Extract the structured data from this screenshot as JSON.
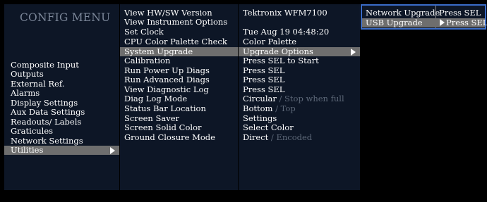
{
  "menu_title": "CONFIG MENU",
  "left_menu": [
    {
      "label": "Composite Input"
    },
    {
      "label": "Outputs"
    },
    {
      "label": "External Ref."
    },
    {
      "label": "Alarms"
    },
    {
      "label": "Display Settings"
    },
    {
      "label": "Aux Data Settings"
    },
    {
      "label": "Readouts/ Labels"
    },
    {
      "label": "Graticules"
    },
    {
      "label": "Network Settings"
    },
    {
      "label": "Utilities",
      "selected": true
    }
  ],
  "utilities": [
    {
      "label": "View HW/SW Version",
      "value": "Tektronix WFM7100"
    },
    {
      "label": "View Instrument Options",
      "value": ""
    },
    {
      "label": "Set Clock",
      "value": "Tue Aug 19 04:48:20"
    },
    {
      "label": "CPU Color Palette Check",
      "value": "Color Palette"
    },
    {
      "label": "System Upgrade",
      "value": "Upgrade Options",
      "selected": true
    },
    {
      "label": "Calibration",
      "value": "Press SEL to Start"
    },
    {
      "label": "Run Power Up Diags",
      "value": "Press SEL"
    },
    {
      "label": "Run Advanced Diags",
      "value": "Press SEL"
    },
    {
      "label": "View Diagnostic Log",
      "value": "Press SEL"
    },
    {
      "label": "Diag Log Mode",
      "value": "Circular",
      "dim": " / Stop when full"
    },
    {
      "label": "Status Bar Location",
      "value": "Bottom",
      "dim": " / Top"
    },
    {
      "label": "Screen Saver",
      "value": "Settings"
    },
    {
      "label": "Screen Solid Color",
      "value": "Select Color"
    },
    {
      "label": "Ground Closure Mode",
      "value": "Direct",
      "dim": " / Encoded"
    }
  ],
  "upgrade_submenu": [
    {
      "label": "Network Upgrade",
      "value": "Press SEL"
    },
    {
      "label": "USB Upgrade",
      "value": "Press SEL",
      "selected": true
    }
  ],
  "colors": {
    "panel_bg": "#0d1626",
    "selected_bg": "#6e6e6e",
    "title": "#7c8799",
    "dim_text": "#5d6878",
    "submenu_border": "#3a6cc8"
  }
}
